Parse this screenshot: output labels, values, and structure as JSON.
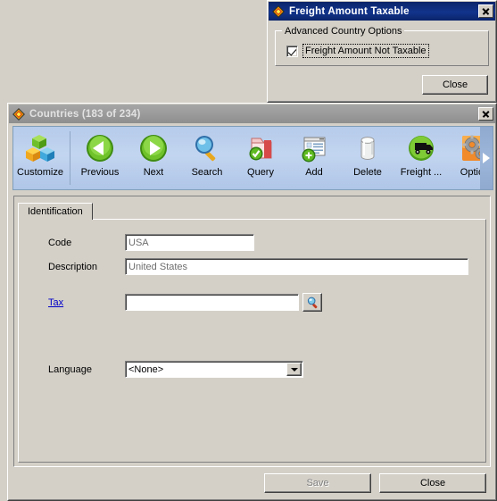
{
  "freight_dialog": {
    "title": "Freight Amount Taxable",
    "icon": "diamond-app-icon",
    "close_icon": "close-icon",
    "group": {
      "title": "Advanced Country Options",
      "checkbox": {
        "label": "Freight Amount Not Taxable",
        "checked": true
      }
    },
    "close_button": "Close"
  },
  "countries_window": {
    "title": "Countries (183 of 234)",
    "icon": "diamond-app-icon",
    "close_icon": "close-icon",
    "toolbar": {
      "items": [
        {
          "label": "Customize",
          "icon": "cubes-icon"
        },
        {
          "label": "Previous",
          "icon": "arrow-left-circle-icon"
        },
        {
          "label": "Next",
          "icon": "arrow-right-circle-icon"
        },
        {
          "label": "Search",
          "icon": "magnifier-icon"
        },
        {
          "label": "Query",
          "icon": "folder-check-icon"
        },
        {
          "label": "Add",
          "icon": "window-plus-icon"
        },
        {
          "label": "Delete",
          "icon": "trash-cylinder-icon"
        },
        {
          "label": "Freight ...",
          "icon": "truck-circle-icon"
        },
        {
          "label": "Option",
          "icon": "gears-icon"
        }
      ],
      "scroll_icon": "chevron-right-icon"
    },
    "tabs": [
      {
        "label": "Identification",
        "active": true
      }
    ],
    "form": {
      "code": {
        "label": "Code",
        "value": "USA"
      },
      "description": {
        "label": "Description",
        "value": "United States"
      },
      "tax": {
        "label": "Tax",
        "value": "",
        "lookup_icon": "magnifier-icon"
      },
      "language": {
        "label": "Language",
        "value": "<None>",
        "dropdown_icon": "chevron-down-icon"
      }
    },
    "buttons": {
      "save": {
        "label": "Save",
        "disabled": true
      },
      "close": {
        "label": "Close",
        "disabled": false
      }
    }
  },
  "colors": {
    "active_title": "#0a246a",
    "inactive_title": "#9b9b9b",
    "window_face": "#d4d0c8",
    "toolbar": "#bdd0ee",
    "link": "#0000c8",
    "readonly_text": "#6e6e6e"
  }
}
